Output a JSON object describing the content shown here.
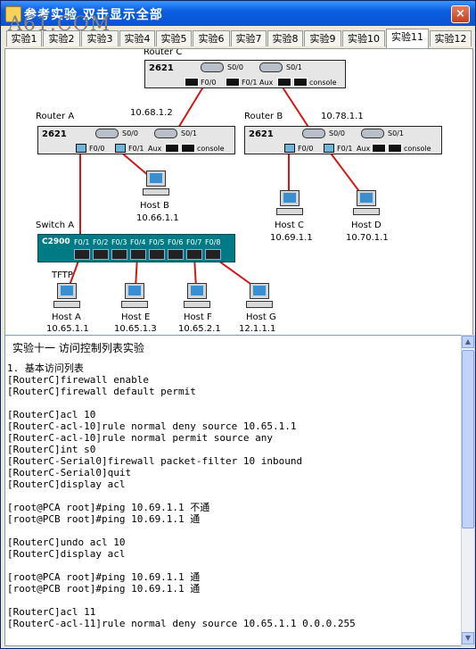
{
  "window": {
    "title": "参考实验  双击显示全部",
    "close_label": "×"
  },
  "watermark": "A61.COM",
  "tabs": [
    {
      "label": "实验1"
    },
    {
      "label": "实验2"
    },
    {
      "label": "实验3"
    },
    {
      "label": "实验4"
    },
    {
      "label": "实验5"
    },
    {
      "label": "实验6"
    },
    {
      "label": "实验7"
    },
    {
      "label": "实验8"
    },
    {
      "label": "实验9"
    },
    {
      "label": "实验10"
    },
    {
      "label": "实验11"
    },
    {
      "label": "实验12"
    }
  ],
  "active_tab": "实验11",
  "topology": {
    "router_c": {
      "caption": "Router C",
      "model": "2621",
      "s0": "S0/0",
      "s1": "S0/1",
      "f0": "F0/0",
      "f1": "F0/1",
      "aux": "Aux",
      "console": "console"
    },
    "router_a": {
      "caption": "Router A",
      "model": "2621",
      "s0": "S0/0",
      "s1": "S0/1",
      "f0": "F0/0",
      "f1": "F0/1",
      "aux": "Aux",
      "console": "console"
    },
    "router_b": {
      "caption": "Router B",
      "model": "2621",
      "s0": "S0/0",
      "s1": "S0/1",
      "f0": "F0/0",
      "f1": "F0/1",
      "aux": "Aux",
      "console": "console"
    },
    "link_ac_ip": "10.68.1.2",
    "link_bc_ip": "10.78.1.1",
    "switch_a": {
      "caption": "Switch A",
      "model": "C2900",
      "ports": [
        "F0/1",
        "F0/2",
        "F0/3",
        "F0/4",
        "F0/5",
        "F0/6",
        "F0/7",
        "F0/8"
      ]
    },
    "tftp": "TFTP",
    "hosts": [
      {
        "name": "Host B",
        "ip": "10.66.1.1"
      },
      {
        "name": "Host C",
        "ip": "10.69.1.1"
      },
      {
        "name": "Host D",
        "ip": "10.70.1.1"
      },
      {
        "name": "Host A",
        "ip": "10.65.1.1"
      },
      {
        "name": "Host E",
        "ip": "10.65.1.3"
      },
      {
        "name": "Host F",
        "ip": "10.65.2.1"
      },
      {
        "name": "Host G",
        "ip": "12.1.1.1"
      }
    ],
    "link_color": "#d01818"
  },
  "lab": {
    "heading": "实验十一   访问控制列表实验",
    "lines": [
      "1. 基本访问列表",
      "[RouterC]firewall enable",
      "[RouterC]firewall default permit",
      "",
      "[RouterC]acl 10",
      "[RouterC-acl-10]rule normal deny source 10.65.1.1",
      "[RouterC-acl-10]rule normal permit source any",
      "[RouterC]int s0",
      "[RouterC-Serial0]firewall packet-filter 10 inbound",
      "[RouterC-Serial0]quit",
      "[RouterC]display acl",
      "",
      "[root@PCA root]#ping 10.69.1.1 不通",
      "[root@PCB root]#ping 10.69.1.1 通",
      "",
      "[RouterC]undo acl 10",
      "[RouterC]display acl",
      "",
      "[root@PCA root]#ping 10.69.1.1 通",
      "[root@PCB root]#ping 10.69.1.1 通",
      "",
      "[RouterC]acl 11",
      "[RouterC-acl-11]rule normal deny source 10.65.1.1 0.0.0.255"
    ]
  }
}
